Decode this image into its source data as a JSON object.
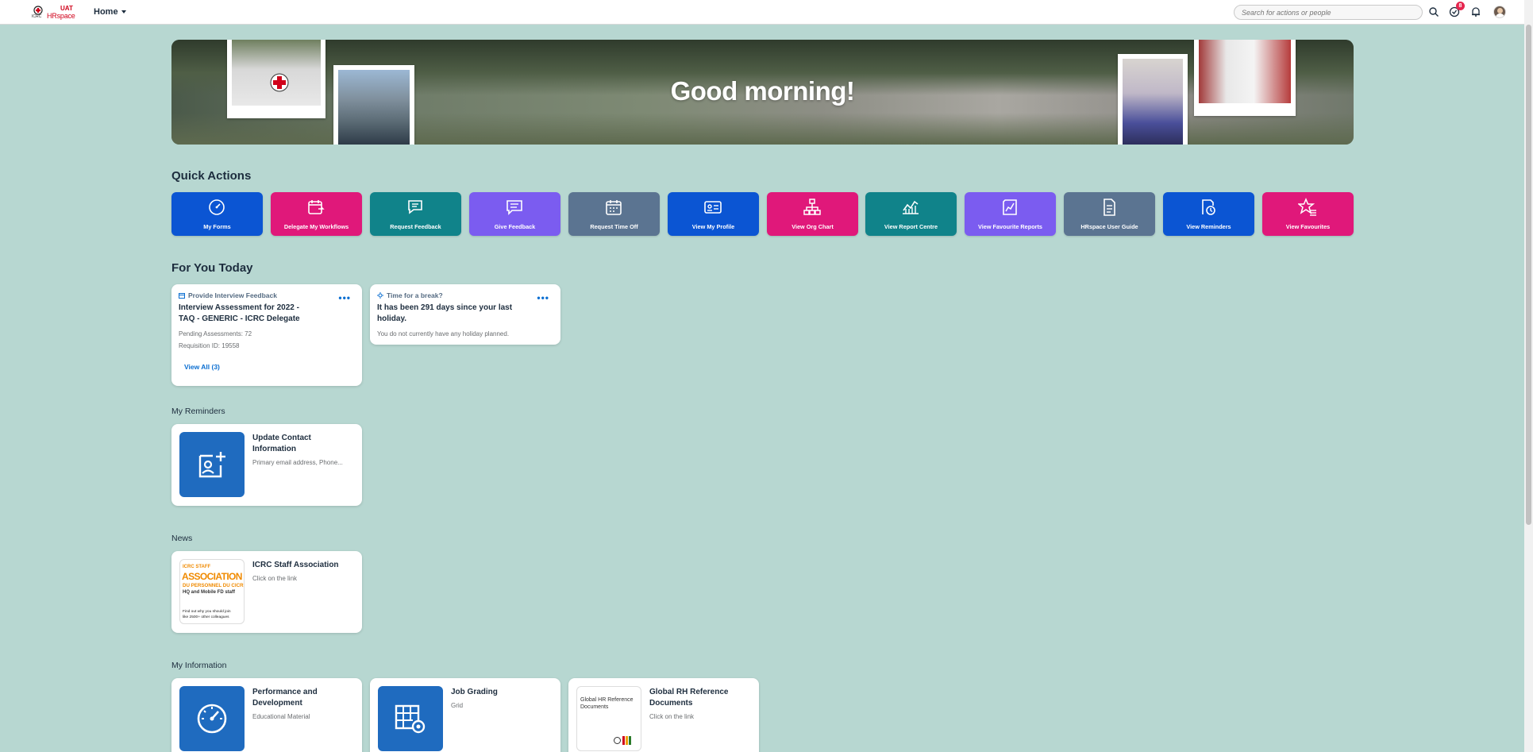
{
  "header": {
    "logo_org": "ICRC",
    "logo_env": "UAT",
    "logo_app": "HRspace",
    "menu_label": "Home",
    "search_placeholder": "Search for actions or people",
    "notification_count": "8"
  },
  "banner": {
    "greeting": "Good morning!"
  },
  "quick_actions": {
    "title": "Quick Actions",
    "items": [
      {
        "label": "My Forms",
        "icon": "gauge-icon",
        "color": "#0b55d3"
      },
      {
        "label": "Delegate My Workflows",
        "icon": "calendar-delegate-icon",
        "color": "#e0187a"
      },
      {
        "label": "Request Feedback",
        "icon": "chat-request-icon",
        "color": "#10838a"
      },
      {
        "label": "Give Feedback",
        "icon": "chat-give-icon",
        "color": "#7b5cf0"
      },
      {
        "label": "Request Time Off",
        "icon": "calendar-icon",
        "color": "#5b7491"
      },
      {
        "label": "View My Profile",
        "icon": "id-card-icon",
        "color": "#0b55d3"
      },
      {
        "label": "View Org Chart",
        "icon": "org-chart-icon",
        "color": "#e0187a"
      },
      {
        "label": "View Report Centre",
        "icon": "line-chart-icon",
        "color": "#10838a"
      },
      {
        "label": "View Favourite Reports",
        "icon": "report-icon",
        "color": "#7b5cf0"
      },
      {
        "label": "HRspace User Guide",
        "icon": "document-icon",
        "color": "#5b7491"
      },
      {
        "label": "View Reminders",
        "icon": "reminder-icon",
        "color": "#0b55d3"
      },
      {
        "label": "View Favourites",
        "icon": "star-list-icon",
        "color": "#e0187a"
      }
    ]
  },
  "for_you_today": {
    "title": "For You Today",
    "cards": [
      {
        "kicker": "Provide Interview Feedback",
        "title": "Interview Assessment for 2022 - TAQ - GENERIC - ICRC Delegate",
        "meta1": "Pending Assessments: 72",
        "meta2": "Requisition ID: 19558",
        "link": "View All (3)"
      },
      {
        "kicker": "Time for a break?",
        "title": "It has been 291 days since your last holiday.",
        "meta1": "You do not currently have any holiday planned."
      }
    ]
  },
  "reminders": {
    "title": "My Reminders",
    "items": [
      {
        "title": "Update Contact Information",
        "sub": "Primary email address, Phone..."
      }
    ]
  },
  "news": {
    "title": "News",
    "items": [
      {
        "title": "ICRC Staff Association",
        "sub": "Click on the link",
        "thumb_lines": [
          "ICRC STAFF",
          "ASSOCIATION",
          "DU PERSONNEL DU CICR",
          "HQ and Mobile FD staff",
          "Find out why you should join",
          "like 2500+ other colleagues"
        ]
      }
    ]
  },
  "my_information": {
    "title": "My Information",
    "items": [
      {
        "title": "Performance and Development",
        "sub": "Educational Material"
      },
      {
        "title": "Job Grading",
        "sub": "Grid"
      },
      {
        "title": "Global RH Reference Documents",
        "sub": "Click on the link",
        "thumb_text": "Global HR Reference Documents"
      }
    ]
  }
}
